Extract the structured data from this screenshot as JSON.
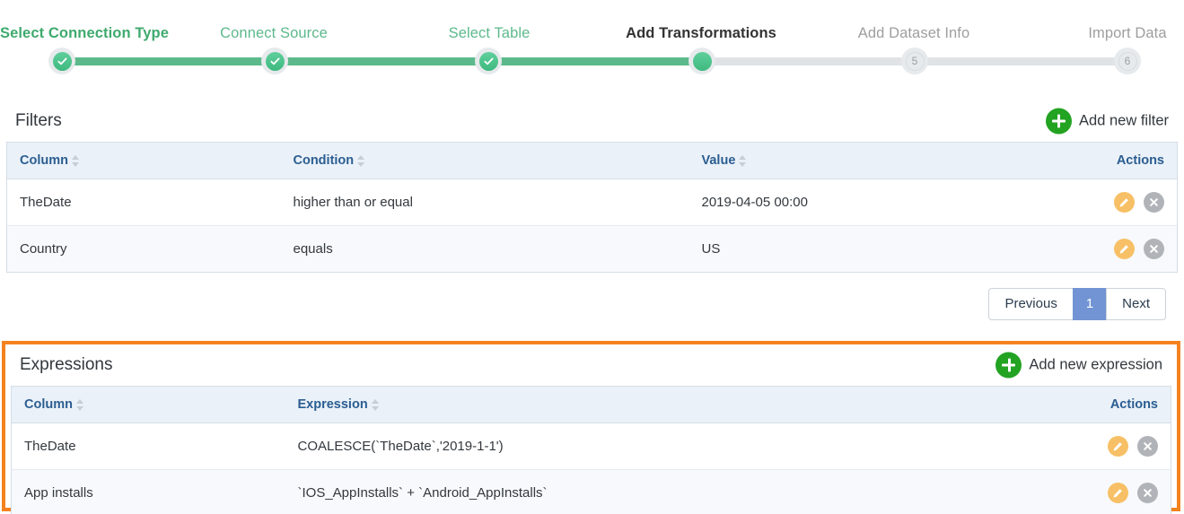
{
  "stepper": {
    "steps": [
      {
        "label": "Select Connection Type",
        "state": "done",
        "marker": "check"
      },
      {
        "label": "Connect Source",
        "state": "done",
        "marker": "check"
      },
      {
        "label": "Select Table",
        "state": "done",
        "marker": "check"
      },
      {
        "label": "Add Transformations",
        "state": "current",
        "marker": ""
      },
      {
        "label": "Add Dataset Info",
        "state": "todo",
        "marker": "5"
      },
      {
        "label": "Import Data",
        "state": "todo",
        "marker": "6"
      }
    ],
    "colors": {
      "done": "#5cb98b",
      "current_text": "#333333",
      "todo": "#9e9e9e",
      "track": "#dfe3e6"
    }
  },
  "filters": {
    "title": "Filters",
    "add_label": "Add new filter",
    "add_icon": "plus-icon",
    "columns": [
      "Column",
      "Condition",
      "Value",
      "Actions"
    ],
    "rows": [
      {
        "column": "TheDate",
        "condition": "higher than or equal",
        "value": "2019-04-05 00:00",
        "edit_icon": "pencil-icon",
        "delete_icon": "close-icon"
      },
      {
        "column": "Country",
        "condition": "equals",
        "value": "US",
        "edit_icon": "pencil-icon",
        "delete_icon": "close-icon"
      }
    ],
    "pagination": {
      "previous": "Previous",
      "pages": [
        "1"
      ],
      "active_page": "1",
      "next": "Next"
    }
  },
  "expressions": {
    "title": "Expressions",
    "add_label": "Add new expression",
    "add_icon": "plus-icon",
    "columns": [
      "Column",
      "Expression",
      "Actions"
    ],
    "rows": [
      {
        "column": "TheDate",
        "expression": "COALESCE(`TheDate`,'2019-1-1')",
        "edit_icon": "pencil-icon",
        "delete_icon": "close-icon"
      },
      {
        "column": "App installs",
        "expression": "`IOS_AppInstalls` + `Android_AppInstalls`",
        "edit_icon": "pencil-icon",
        "delete_icon": "close-icon"
      }
    ],
    "highlight_color": "#f3821f"
  }
}
